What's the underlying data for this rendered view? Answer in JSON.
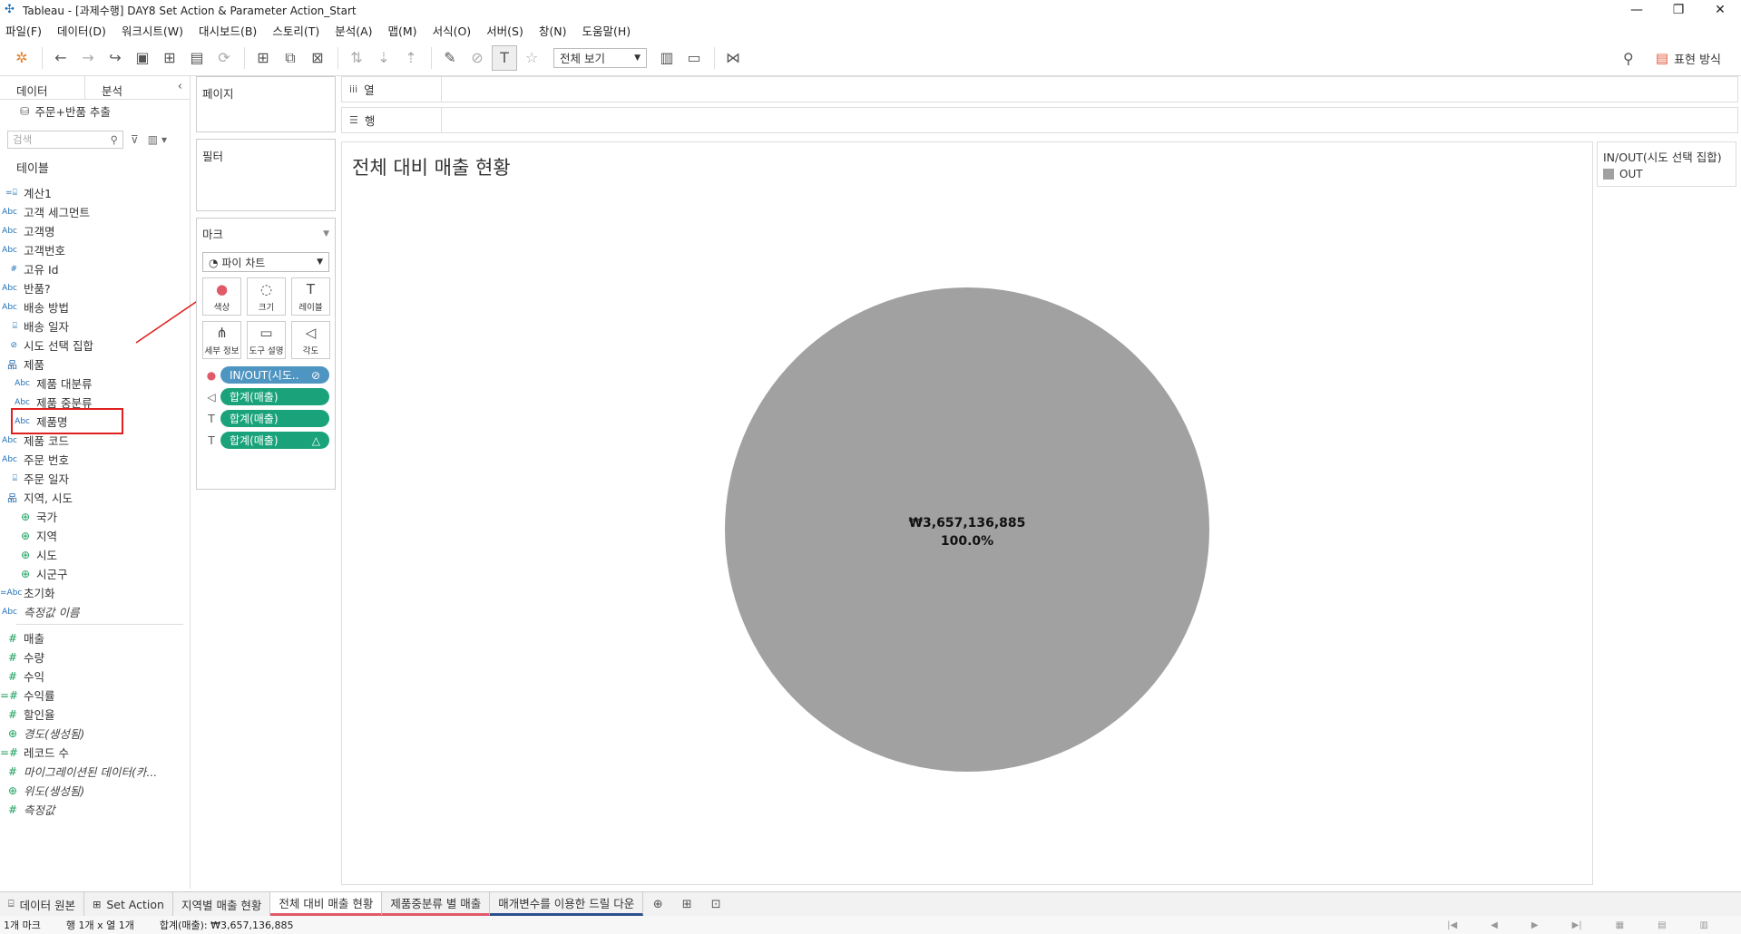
{
  "window": {
    "title": "Tableau - [과제수행] DAY8 Set Action & Parameter Action_Start",
    "minimize": "—",
    "maximize": "❐",
    "close": "✕"
  },
  "menu": [
    "파일(F)",
    "데이터(D)",
    "워크시트(W)",
    "대시보드(B)",
    "스토리(T)",
    "분석(A)",
    "맵(M)",
    "서식(O)",
    "서버(S)",
    "창(N)",
    "도움말(H)"
  ],
  "toolbar": {
    "view_select": "전체 보기",
    "show_me": "표현 방식"
  },
  "data_pane": {
    "tab_data": "데이터",
    "tab_analysis": "분석",
    "datasource": "주문+반품 추출",
    "search_placeholder": "검색",
    "tables_header": "테이블"
  },
  "fields": [
    {
      "icon": "=⌸",
      "name": "계산1"
    },
    {
      "icon": "Abc",
      "name": "고객 세그먼트"
    },
    {
      "icon": "Abc",
      "name": "고객명"
    },
    {
      "icon": "Abc",
      "name": "고객번호"
    },
    {
      "icon": "#",
      "name": "고유 Id"
    },
    {
      "icon": "Abc",
      "name": "반품?"
    },
    {
      "icon": "Abc",
      "name": "배송 방법"
    },
    {
      "icon": "⌸",
      "name": "배송 일자"
    },
    {
      "icon": "⊘",
      "name": "시도 선택 집합"
    },
    {
      "icon": "品",
      "name": "제품",
      "hier": true
    },
    {
      "icon": "Abc",
      "name": "제품 대분류",
      "lv1": true
    },
    {
      "icon": "Abc",
      "name": "제품 중분류",
      "lv1": true
    },
    {
      "icon": "Abc",
      "name": "제품명",
      "lv1": true
    },
    {
      "icon": "Abc",
      "name": "제품 코드"
    },
    {
      "icon": "Abc",
      "name": "주문 번호"
    },
    {
      "icon": "⌸",
      "name": "주문 일자"
    },
    {
      "icon": "品",
      "name": "지역, 시도",
      "hier": true
    },
    {
      "icon": "⊕",
      "name": "국가",
      "lv1": true,
      "geo": true
    },
    {
      "icon": "⊕",
      "name": "지역",
      "lv1": true,
      "geo": true
    },
    {
      "icon": "⊕",
      "name": "시도",
      "lv1": true,
      "geo": true
    },
    {
      "icon": "⊕",
      "name": "시군구",
      "lv1": true,
      "geo": true
    },
    {
      "icon": "=Abc",
      "name": "초기화"
    },
    {
      "icon": "Abc",
      "name": "측정값 이름",
      "italic": true
    }
  ],
  "measures": [
    {
      "icon": "#",
      "name": "매출"
    },
    {
      "icon": "#",
      "name": "수량"
    },
    {
      "icon": "#",
      "name": "수익"
    },
    {
      "icon": "=#",
      "name": "수익률"
    },
    {
      "icon": "#",
      "name": "할인율"
    },
    {
      "icon": "⊕",
      "name": "경도(생성됨)",
      "italic": true
    },
    {
      "icon": "=#",
      "name": "레코드 수"
    },
    {
      "icon": "#",
      "name": "마이그레이션된 데이터(카...",
      "italic": true
    },
    {
      "icon": "⊕",
      "name": "위도(생성됨)",
      "italic": true
    },
    {
      "icon": "#",
      "name": "측정값",
      "italic": true
    }
  ],
  "shelves": {
    "pages": "페이지",
    "filters": "필터",
    "marks": "마크",
    "mark_type": "파이 차트",
    "columns": "열",
    "rows": "행"
  },
  "mark_buttons": [
    {
      "icon": "●",
      "label": "색상"
    },
    {
      "icon": "◌",
      "label": "크기"
    },
    {
      "icon": "T",
      "label": "레이블"
    },
    {
      "icon": "⋔",
      "label": "세부 정보"
    },
    {
      "icon": "▭",
      "label": "도구 설명"
    },
    {
      "icon": "◁",
      "label": "각도"
    }
  ],
  "pills": [
    {
      "icon": "●",
      "label": "IN/OUT(시도..",
      "suffix": "⊘",
      "color": "blue"
    },
    {
      "icon": "◁",
      "label": "합계(매출)",
      "suffix": "",
      "color": "green"
    },
    {
      "icon": "T",
      "label": "합계(매출)",
      "suffix": "",
      "color": "green"
    },
    {
      "icon": "T",
      "label": "합계(매출)",
      "suffix": "△",
      "color": "green"
    }
  ],
  "view": {
    "title": "전체 대비 매출 현황",
    "pie_value": "₩3,657,136,885",
    "pie_percent": "100.0%"
  },
  "chart_data": {
    "type": "pie",
    "categories": [
      "OUT"
    ],
    "values": [
      3657136885
    ],
    "title": "전체 대비 매출 현황",
    "colors": [
      "#a1a1a1"
    ]
  },
  "legend": {
    "title": "IN/OUT(시도 선택 집합)",
    "items": [
      {
        "label": "OUT",
        "color": "#a1a1a1"
      }
    ]
  },
  "sheet_tabs": [
    {
      "label": "데이터 원본",
      "icon": "⌸",
      "style": ""
    },
    {
      "label": "Set Action",
      "icon": "⊞",
      "style": ""
    },
    {
      "label": "지역별 매출 현황",
      "icon": "",
      "style": ""
    },
    {
      "label": "전체 대비 매출 현황",
      "icon": "",
      "style": "active red"
    },
    {
      "label": "제품중분류 별 매출",
      "icon": "",
      "style": "red"
    },
    {
      "label": "매개변수를 이용한 드릴 다운",
      "icon": "",
      "style": "navy"
    }
  ],
  "status": {
    "marks": "1개 마크",
    "rows_cols": "행 1개 x 열 1개",
    "sum": "합계(매출): ₩3,657,136,885"
  }
}
